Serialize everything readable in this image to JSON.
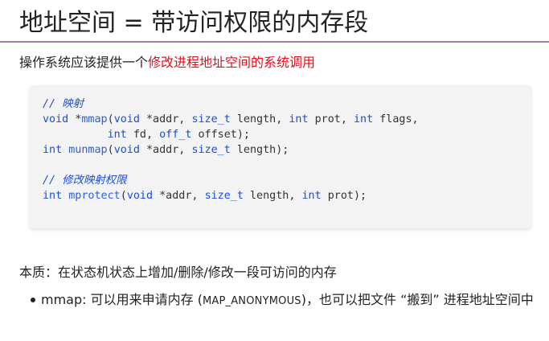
{
  "slide": {
    "title": "地址空间 = 带访问权限的内存段",
    "intro_prefix": "操作系统应该提供一个",
    "intro_highlight": "修改进程地址空间的系统调用",
    "colors": {
      "accent_rule": "#a77bb0",
      "highlight": "#e0101a",
      "code_keyword": "#1a4fd6"
    }
  },
  "code": {
    "comment1": "// 映射",
    "l1_kw": "void",
    "l1_star": " *",
    "l1_fn": "mmap",
    "l1_a": "(",
    "l1_kw2": "void",
    "l1_b": " *addr, ",
    "l1_t1": "size_t",
    "l1_c": " length, ",
    "l1_kw3": "int",
    "l1_d": " prot, ",
    "l1_kw4": "int",
    "l1_e": " flags,",
    "l2_pad": "          ",
    "l2_kw": "int",
    "l2_a": " fd, ",
    "l2_t": "off_t",
    "l2_b": " offset);",
    "l3_kw": "int",
    "l3_sp": " ",
    "l3_fn": "munmap",
    "l3_a": "(",
    "l3_kw2": "void",
    "l3_b": " *addr, ",
    "l3_t": "size_t",
    "l3_c": " length);",
    "comment2": "// 修改映射权限",
    "l4_kw": "int",
    "l4_sp": " ",
    "l4_fn": "mprotect",
    "l4_a": "(",
    "l4_kw2": "void",
    "l4_b": " *addr, ",
    "l4_t": "size_t",
    "l4_c": " length, ",
    "l4_kw3": "int",
    "l4_d": " prot);"
  },
  "summary": "本质：在状态机状态上增加/删除/修改一段可访问的内存",
  "bullet": {
    "part1": "mmap: 可以用来申请内存 (",
    "mono": "MAP_ANONYMOUS",
    "part2": ")，也可以把文件 “搬到” 进程地址空间中"
  }
}
